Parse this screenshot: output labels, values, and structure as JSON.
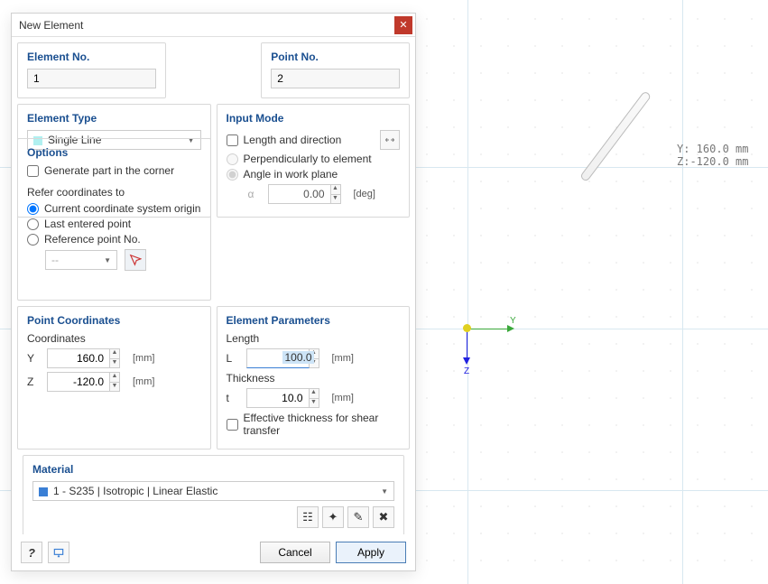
{
  "dialog": {
    "title": "New Element",
    "elementNo": {
      "label": "Element No.",
      "value": "1"
    },
    "pointNo": {
      "label": "Point No.",
      "value": "2"
    },
    "elementType": {
      "label": "Element Type",
      "value": "Single Line",
      "swatch": "#b0f0f0"
    },
    "inputMode": {
      "label": "Input Mode",
      "lengthDir": "Length and direction",
      "perp": "Perpendicularly to element",
      "angle": "Angle in work plane",
      "alpha": "α",
      "alphaVal": "0.00",
      "alphaUnit": "[deg]"
    },
    "options": {
      "label": "Options",
      "genPart": "Generate part in the corner",
      "referLabel": "Refer coordinates to",
      "r1": "Current coordinate system origin",
      "r2": "Last entered point",
      "r3": "Reference point No.",
      "refDropdown": "--"
    },
    "pointCoords": {
      "label": "Point Coordinates",
      "coordsLabel": "Coordinates",
      "yLabel": "Y",
      "yVal": "160.0",
      "yUnit": "[mm]",
      "zLabel": "Z",
      "zVal": "-120.0",
      "zUnit": "[mm]"
    },
    "elemParams": {
      "label": "Element Parameters",
      "lengthLabel": "Length",
      "lLabel": "L",
      "lVal": "100.0",
      "lUnit": "[mm]",
      "thickLabel": "Thickness",
      "tLabel": "t",
      "tVal": "10.0",
      "tUnit": "[mm]",
      "effThick": "Effective thickness for shear transfer"
    },
    "material": {
      "label": "Material",
      "value": "1 - S235 | Isotropic | Linear Elastic",
      "swatch": "#3a7fd5"
    },
    "buttons": {
      "cancel": "Cancel",
      "apply": "Apply"
    }
  },
  "viewport": {
    "axisY": "Y",
    "axisZ": "Z",
    "readout": "Y: 160.0 mm\nZ:-120.0 mm"
  }
}
